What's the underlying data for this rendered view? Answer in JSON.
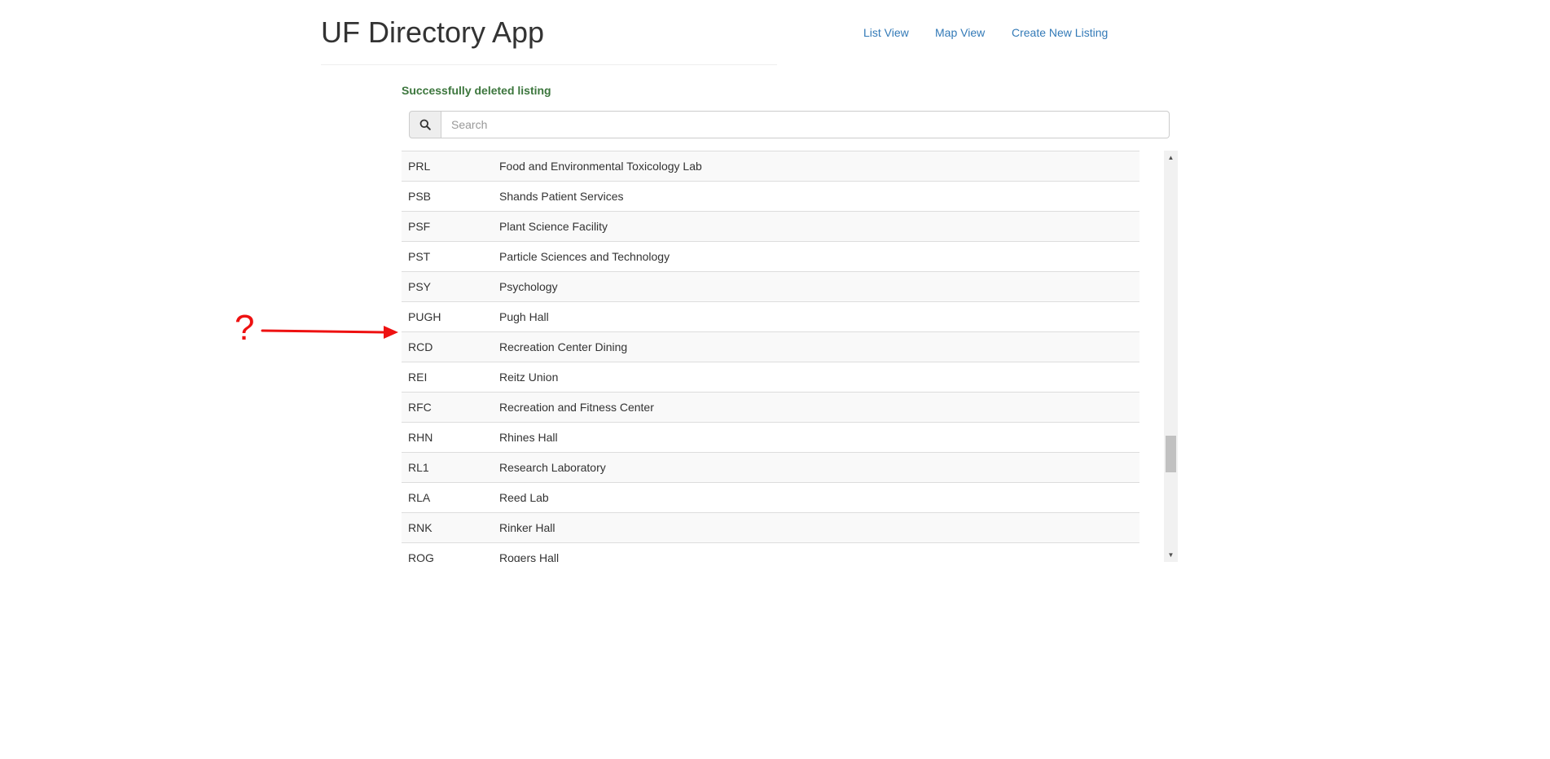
{
  "header": {
    "title": "UF Directory App",
    "nav": [
      {
        "label": "List View"
      },
      {
        "label": "Map View"
      },
      {
        "label": "Create New Listing"
      }
    ]
  },
  "flash": {
    "message": "Successfully deleted listing",
    "color": "#3c763d"
  },
  "search": {
    "placeholder": "Search",
    "value": "",
    "icon": "search-icon"
  },
  "listings": {
    "rows": [
      {
        "code": "PRL",
        "name": "Food and Environmental Toxicology Lab"
      },
      {
        "code": "PSB",
        "name": "Shands Patient Services"
      },
      {
        "code": "PSF",
        "name": "Plant Science Facility"
      },
      {
        "code": "PST",
        "name": "Particle Sciences and Technology"
      },
      {
        "code": "PSY",
        "name": "Psychology"
      },
      {
        "code": "PUGH",
        "name": "Pugh Hall"
      },
      {
        "code": "RCD",
        "name": "Recreation Center Dining"
      },
      {
        "code": "REI",
        "name": "Reitz Union"
      },
      {
        "code": "RFC",
        "name": "Recreation and Fitness Center"
      },
      {
        "code": "RHN",
        "name": "Rhines Hall"
      },
      {
        "code": "RL1",
        "name": "Research Laboratory"
      },
      {
        "code": "RLA",
        "name": "Reed Lab"
      },
      {
        "code": "RNK",
        "name": "Rinker Hall"
      },
      {
        "code": "ROG",
        "name": "Rogers Hall"
      }
    ]
  },
  "annotation": {
    "symbol": "?",
    "color": "#ee1111"
  },
  "colors": {
    "link": "#337ab7",
    "row_stripe": "#f9f9f9",
    "border": "#dddddd"
  }
}
